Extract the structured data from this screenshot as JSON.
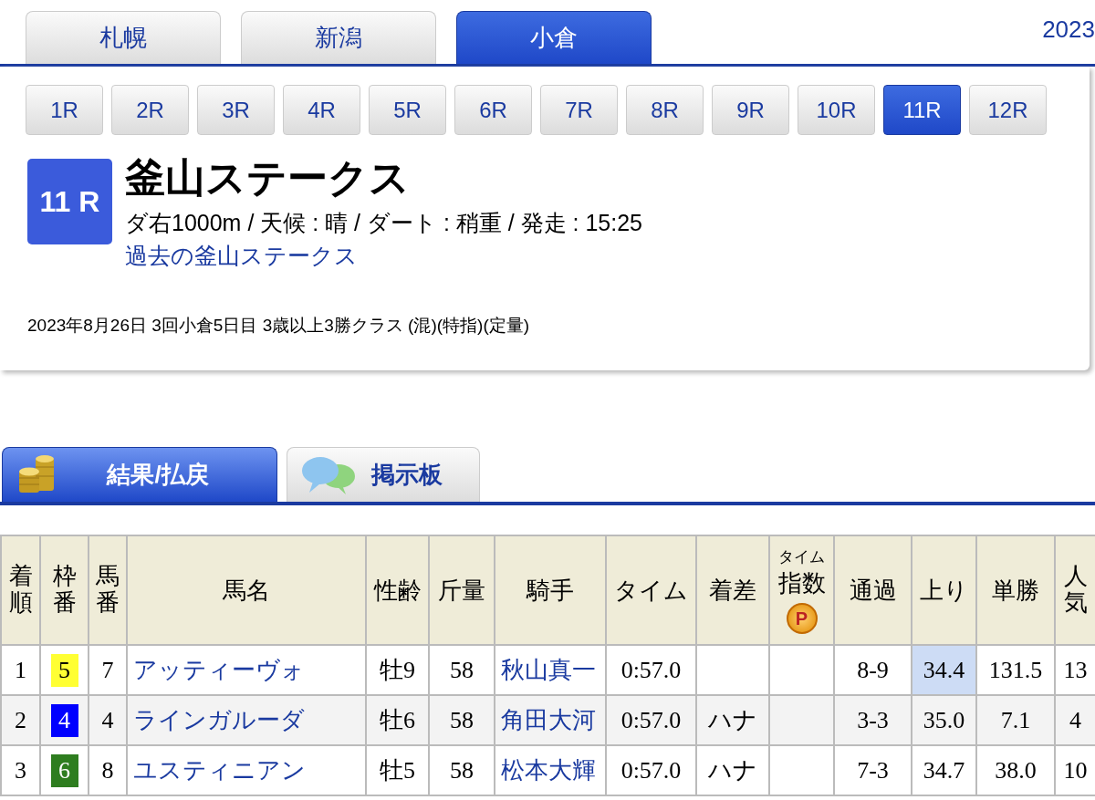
{
  "venue_tabs": [
    {
      "label": "札幌",
      "selected": false
    },
    {
      "label": "新潟",
      "selected": false
    },
    {
      "label": "小倉",
      "selected": true
    }
  ],
  "header_date": "2023",
  "race_tabs": [
    {
      "label": "1R",
      "selected": false
    },
    {
      "label": "2R",
      "selected": false
    },
    {
      "label": "3R",
      "selected": false
    },
    {
      "label": "4R",
      "selected": false
    },
    {
      "label": "5R",
      "selected": false
    },
    {
      "label": "6R",
      "selected": false
    },
    {
      "label": "7R",
      "selected": false
    },
    {
      "label": "8R",
      "selected": false
    },
    {
      "label": "9R",
      "selected": false
    },
    {
      "label": "10R",
      "selected": false
    },
    {
      "label": "11R",
      "selected": true
    },
    {
      "label": "12R",
      "selected": false
    }
  ],
  "race": {
    "badge": "11 R",
    "title": "釜山ステークス",
    "info": "ダ右1000m / 天候 : 晴 / ダート : 稍重 / 発走 : 15:25",
    "past_link": "過去の釜山ステークス",
    "details": "2023年8月26日 3回小倉5日目 3歳以上3勝クラス  (混)(特指)(定量)"
  },
  "content_tabs": [
    {
      "label": "結果/払戻",
      "kind": "coins",
      "selected": true
    },
    {
      "label": "掲示板",
      "kind": "chat",
      "selected": false
    }
  ],
  "table": {
    "columns": [
      {
        "kind": "vertical",
        "label": "着順"
      },
      {
        "kind": "vertical",
        "label": "枠番"
      },
      {
        "kind": "vertical",
        "label": "馬番"
      },
      {
        "kind": "plain",
        "label": "馬名"
      },
      {
        "kind": "plain",
        "label": "性齢"
      },
      {
        "kind": "plain",
        "label": "斤量"
      },
      {
        "kind": "plain",
        "label": "騎手"
      },
      {
        "kind": "plain",
        "label": "タイム"
      },
      {
        "kind": "plain",
        "label": "着差"
      },
      {
        "kind": "index",
        "small": "タイム",
        "label": "指数",
        "badge": "P"
      },
      {
        "kind": "plain",
        "label": "通過"
      },
      {
        "kind": "plain",
        "label": "上り"
      },
      {
        "kind": "plain",
        "label": "単勝"
      },
      {
        "kind": "vertical",
        "label": "人気"
      }
    ],
    "rows": [
      {
        "rank": "1",
        "frame": "5",
        "color": "#ffff33",
        "number": "7",
        "horse": "アッティーヴォ",
        "sex_age": "牡9",
        "weight": "58",
        "jockey": "秋山真一",
        "time": "0:57.0",
        "margin": "",
        "passing": "8-9",
        "last3f": "34.4",
        "fastest": true,
        "odds": "131.5",
        "popularity": "13"
      },
      {
        "rank": "2",
        "frame": "4",
        "color": "#0000ff",
        "number": "4",
        "horse": "ラインガルーダ",
        "sex_age": "牡6",
        "weight": "58",
        "jockey": "角田大河",
        "time": "0:57.0",
        "margin": "ハナ",
        "passing": "3-3",
        "last3f": "35.0",
        "fastest": false,
        "odds": "7.1",
        "popularity": "4"
      },
      {
        "rank": "3",
        "frame": "6",
        "color": "#2e7d1f",
        "number": "8",
        "horse": "ユスティニアン",
        "sex_age": "牡5",
        "weight": "58",
        "jockey": "松本大輝",
        "time": "0:57.0",
        "margin": "ハナ",
        "passing": "7-3",
        "last3f": "34.7",
        "fastest": false,
        "odds": "38.0",
        "popularity": "10"
      }
    ]
  }
}
